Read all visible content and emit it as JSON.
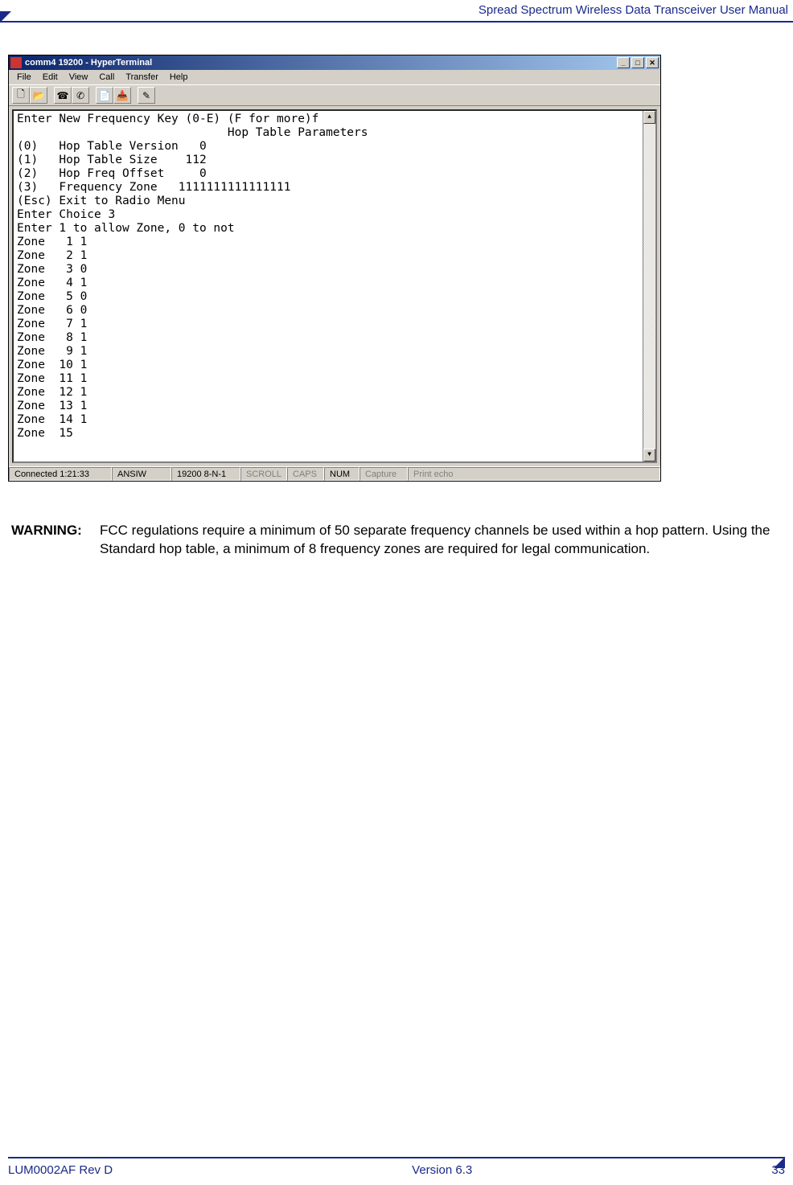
{
  "header": {
    "title": "Spread Spectrum Wireless Data Transceiver User Manual"
  },
  "window": {
    "title": "comm4 19200 - HyperTerminal",
    "menus": [
      "File",
      "Edit",
      "View",
      "Call",
      "Transfer",
      "Help"
    ],
    "win_buttons": {
      "min": "_",
      "max": "□",
      "close": "✕"
    }
  },
  "terminal_text": "Enter New Frequency Key (0-E) (F for more)f\n                              Hop Table Parameters\n(0)   Hop Table Version   0\n(1)   Hop Table Size    112\n(2)   Hop Freq Offset     0\n(3)   Frequency Zone   1111111111111111\n(Esc) Exit to Radio Menu\nEnter Choice 3\nEnter 1 to allow Zone, 0 to not\nZone   1 1\nZone   2 1\nZone   3 0\nZone   4 1\nZone   5 0\nZone   6 0\nZone   7 1\nZone   8 1\nZone   9 1\nZone  10 1\nZone  11 1\nZone  12 1\nZone  13 1\nZone  14 1\nZone  15 ",
  "statusbar": {
    "connected": "Connected 1:21:33",
    "emu": "ANSIW",
    "port": "19200 8-N-1",
    "scroll": "SCROLL",
    "caps": "CAPS",
    "num": "NUM",
    "capture": "Capture",
    "echo": "Print echo"
  },
  "warning": {
    "label": "WARNING:",
    "text": "FCC regulations require a minimum of 50 separate frequency channels be used within a hop pattern. Using the Standard hop table, a minimum of 8 frequency zones are required for legal communication."
  },
  "footer": {
    "left": "LUM0002AF Rev D",
    "center": "Version 6.3",
    "right": "33"
  },
  "toolbar_icons": [
    "new-icon",
    "open-icon",
    "connect-icon",
    "disconnect-icon",
    "send-icon",
    "receive-icon",
    "properties-icon"
  ]
}
